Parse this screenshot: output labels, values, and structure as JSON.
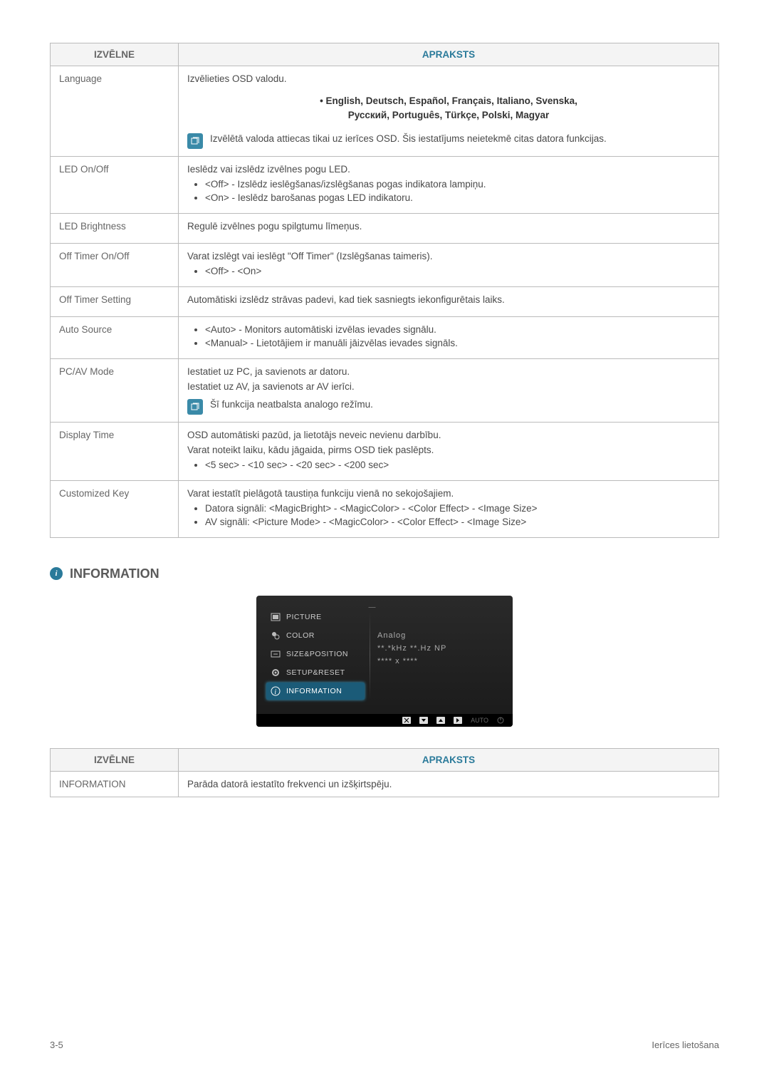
{
  "table1": {
    "headers": {
      "menu": "IZVĒLNE",
      "desc": "APRAKSTS"
    },
    "rows": {
      "language": {
        "label": "Language",
        "intro": "Izvēlieties OSD valodu.",
        "langs1": "• English, Deutsch, Español, Français, Italiano, Svenska,",
        "langs2": "Русский, Português, Türkçe, Polski, Magyar",
        "note": "Izvēlētā valoda attiecas tikai uz ierīces OSD. Šis iestatījums neietekmē citas datora funkcijas."
      },
      "ledonoff": {
        "label": "LED On/Off",
        "intro": "Ieslēdz vai izslēdz izvēlnes pogu LED.",
        "b1": "<Off> - Izslēdz ieslēgšanas/izslēgšanas pogas indikatora lampiņu.",
        "b2": "<On> - Ieslēdz barošanas pogas LED indikatoru."
      },
      "ledbright": {
        "label": "LED Brightness",
        "intro": "Regulē izvēlnes pogu spilgtumu līmeņus."
      },
      "offtimer": {
        "label": "Off Timer On/Off",
        "intro": "Varat izslēgt vai ieslēgt \"Off Timer\" (Izslēgšanas taimeris).",
        "b1": "<Off> - <On>"
      },
      "offtimerset": {
        "label": "Off Timer Setting",
        "intro": "Automātiski izslēdz strāvas padevi, kad tiek sasniegts iekonfigurētais laiks."
      },
      "autosource": {
        "label": "Auto Source",
        "b1": "<Auto> - Monitors automātiski izvēlas ievades signālu.",
        "b2": "<Manual> - Lietotājiem ir manuāli jāizvēlas ievades signāls."
      },
      "pcav": {
        "label": "PC/AV Mode",
        "l1": "Iestatiet uz PC, ja savienots ar datoru.",
        "l2": "Iestatiet uz AV, ja savienots ar AV ierīci.",
        "note": "Šī funkcija neatbalsta analogo režīmu."
      },
      "disptime": {
        "label": "Display Time",
        "l1": "OSD automātiski pazūd, ja lietotājs neveic nevienu darbību.",
        "l2": "Varat noteikt laiku, kādu jāgaida, pirms OSD tiek paslēpts.",
        "b1": "<5 sec> - <10 sec> - <20 sec> - <200 sec>"
      },
      "custkey": {
        "label": "Customized Key",
        "intro": "Varat iestatīt pielāgotā taustiņa funkciju vienā no sekojošajiem.",
        "b1": "Datora signāli: <MagicBright> - <MagicColor> - <Color Effect> - <Image Size>",
        "b2": "AV signāli: <Picture Mode> - <MagicColor> - <Color Effect> - <Image Size>"
      }
    }
  },
  "section": {
    "title": "INFORMATION"
  },
  "osd": {
    "items": {
      "picture": "PICTURE",
      "color": "COLOR",
      "sizepos": "SIZE&POSITION",
      "setup": "SETUP&RESET",
      "info": "INFORMATION"
    },
    "r1": "Analog",
    "r2": "**.*kHz  **.Hz  NP",
    "r3": "****  x  ****",
    "auto": "AUTO"
  },
  "table2": {
    "headers": {
      "menu": "IZVĒLNE",
      "desc": "APRAKSTS"
    },
    "row": {
      "label": "INFORMATION",
      "desc": "Parāda datorā iestatīto frekvenci un izšķirtspēju."
    }
  },
  "footer": {
    "left": "3-5",
    "right": "Ierīces lietošana"
  }
}
